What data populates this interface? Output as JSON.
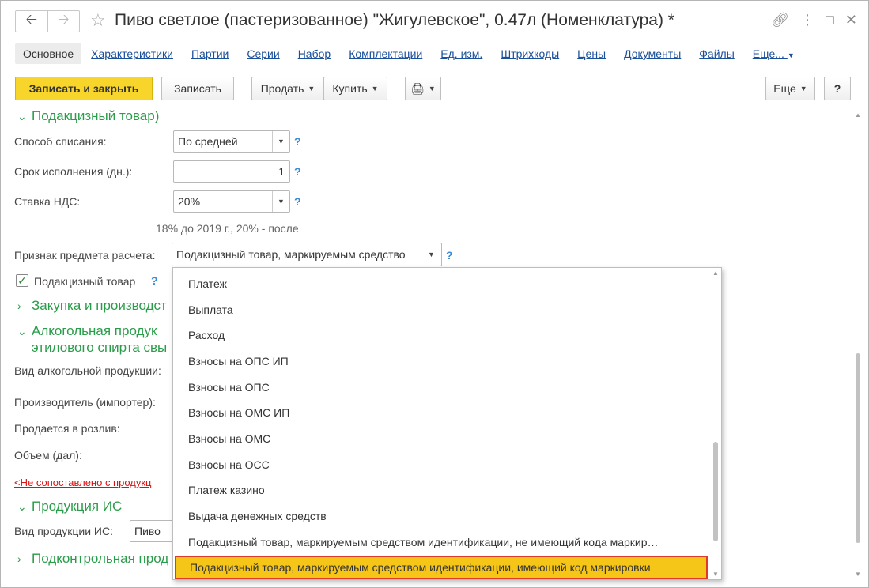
{
  "window": {
    "title": "Пиво светлое (пастеризованное) \"Жигулевское\", 0.47л (Номенклатура) *",
    "back_icon": "arrow-left-icon",
    "forward_icon": "arrow-right-icon"
  },
  "tabs": [
    {
      "label": "Основное",
      "active": true
    },
    {
      "label": "Характеристики"
    },
    {
      "label": "Партии"
    },
    {
      "label": "Серии"
    },
    {
      "label": "Набор"
    },
    {
      "label": "Комплектации"
    },
    {
      "label": "Ед. изм."
    },
    {
      "label": "Штрихкоды"
    },
    {
      "label": "Цены"
    },
    {
      "label": "Документы"
    },
    {
      "label": "Файлы"
    },
    {
      "label": "Еще..."
    }
  ],
  "toolbar": {
    "save_close": "Записать и закрыть",
    "save": "Записать",
    "sell": "Продать",
    "buy": "Купить",
    "more": "Еще",
    "help": "?"
  },
  "form": {
    "excise_header": "Подакцизный товар)",
    "writeoff_label": "Способ списания:",
    "writeoff_value": "По средней",
    "term_label": "Срок исполнения (дн.):",
    "term_value": "1",
    "vat_label": "Ставка НДС:",
    "vat_value": "20%",
    "vat_hint": "18% до 2019 г., 20% - после",
    "payment_subject_label": "Признак предмета расчета:",
    "payment_subject_value": "Подакцизный товар, маркируемым средство",
    "excise_checkbox_label": "Подакцизный товар",
    "purchase_header": "Закупка и производст",
    "alcohol_header_1": "Алкогольная продук",
    "alcohol_header_2": "этилового спирта свы",
    "alcohol_kind_label": "Вид алкогольной продукции:",
    "producer_label": "Производитель (импортер):",
    "draught_label": "Продается в розлив:",
    "volume_label": "Объем (дал):",
    "unmatched_link": "<Не сопоставлено с продукц",
    "is_header": "Продукция ИС",
    "is_kind_label": "Вид продукции ИС:",
    "is_kind_value": "Пиво",
    "controlled_header": "Подконтрольная прод",
    "help_mark": "?"
  },
  "dropdown": {
    "items": [
      "Платеж",
      "Выплата",
      "Расход",
      "Взносы на ОПС ИП",
      "Взносы на ОПС",
      "Взносы на ОМС ИП",
      "Взносы на ОМС",
      "Взносы на ОСС",
      "Платеж казино",
      "Выдача денежных средств",
      "Подакцизный товар, маркируемым средством идентификации, не имеющий кода маркир…",
      "Подакцизный товар, маркируемым средством идентификации, имеющий код маркировки"
    ],
    "selected_index": 11
  },
  "colors": {
    "primary_button": "#f7d52b",
    "section_green": "#2a9d4a",
    "link_blue": "#1a4f9c",
    "help_blue": "#3b8ad8",
    "highlight_border": "#e03a2a"
  }
}
